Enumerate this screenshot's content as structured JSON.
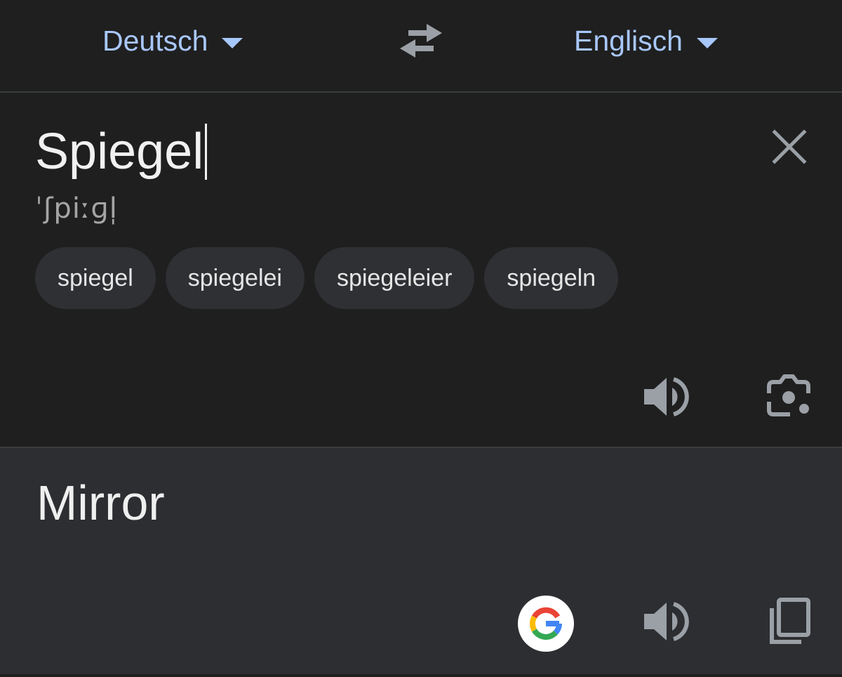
{
  "languages": {
    "source": "Deutsch",
    "target": "Englisch"
  },
  "input": {
    "text": "Spiegel",
    "phonetic": "ˈʃpiːɡl̩"
  },
  "suggestions": [
    "spiegel",
    "spiegelei",
    "spiegeleier",
    "spiegeln"
  ],
  "output": {
    "text": "Mirror"
  },
  "icons": {
    "swap": "swap-arrows-icon",
    "clear": "close-icon",
    "speaker": "speaker-icon",
    "lens": "camera-lens-icon",
    "google": "google-g-icon",
    "copy": "copy-icon"
  },
  "colors": {
    "background": "#1f1f1f",
    "output_background": "#2d2e31",
    "accent": "#a8c7fa",
    "chip": "#2f3034",
    "icon": "#9aa0a6"
  }
}
